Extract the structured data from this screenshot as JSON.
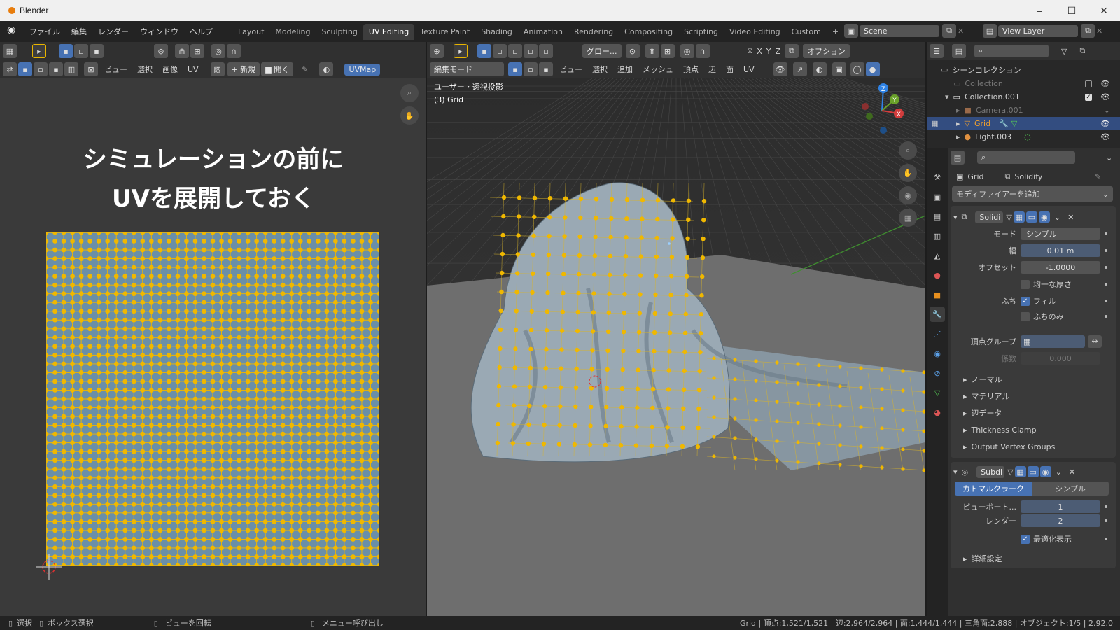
{
  "window": {
    "title": "Blender",
    "min": "–",
    "max": "☐",
    "close": "✕"
  },
  "menus": [
    "ファイル",
    "編集",
    "レンダー",
    "ウィンドウ",
    "ヘルプ"
  ],
  "workspaces": [
    "Layout",
    "Modeling",
    "Sculpting",
    "UV Editing",
    "Texture Paint",
    "Shading",
    "Animation",
    "Rendering",
    "Compositing",
    "Scripting",
    "Video Editing",
    "Custom"
  ],
  "active_workspace": "UV Editing",
  "add_workspace": "+",
  "scene": {
    "label": "Scene",
    "view_layer": "View Layer"
  },
  "uv_editor": {
    "menus": [
      "ビュー",
      "選択",
      "画像",
      "UV"
    ],
    "new_label": "新規",
    "open_label": "開く",
    "uvmap_label": "UVMap",
    "title_line1": "シミュレーションの前に",
    "title_line2": "UVを展開しておく"
  },
  "viewport": {
    "mode_label": "編集モード",
    "menus": [
      "ビュー",
      "選択",
      "追加",
      "メッシュ",
      "頂点",
      "辺",
      "面",
      "UV"
    ],
    "transform_label": "グロー...",
    "options_label": "オプション",
    "axes": [
      "X",
      "Y",
      "Z"
    ],
    "overlay_line1": "ユーザー・透視投影",
    "overlay_line2": "(3) Grid",
    "gizmo_axes": [
      "Z",
      "Y",
      "X"
    ]
  },
  "outliner": {
    "header": "シーンコレクション",
    "items": [
      {
        "label": "Collection",
        "dim": true
      },
      {
        "label": "Collection.001",
        "dim": false
      },
      {
        "label": "Camera.001",
        "dim": true
      },
      {
        "label": "Grid",
        "dim": false,
        "selected": true
      },
      {
        "label": "Light.003",
        "dim": false
      }
    ]
  },
  "properties": {
    "object_name": "Grid",
    "modifier_name_top": "Solidify",
    "add_modifier": "モディファイアーを追加",
    "solidify": {
      "name": "Solidi",
      "mode_label": "モード",
      "mode_value": "シンプル",
      "width_label": "幅",
      "width_value": "0.01 m",
      "offset_label": "オフセット",
      "offset_value": "-1.0000",
      "even_label": "均一な厚さ",
      "rim_label": "ふち",
      "fill_label": "フィル",
      "rim_only_label": "ふちのみ",
      "vgroup_label": "頂点グループ",
      "factor_label": "係数",
      "factor_value": "0.000",
      "sections": [
        "ノーマル",
        "マテリアル",
        "辺データ",
        "Thickness Clamp",
        "Output Vertex Groups"
      ]
    },
    "subdivision": {
      "name": "Subdi",
      "catmull_label": "カトマルクラーク",
      "simple_label": "シンプル",
      "viewport_label": "ビューポート...",
      "viewport_value": "1",
      "render_label": "レンダー",
      "render_value": "2",
      "optimal_label": "最適化表示",
      "advanced_label": "詳細設定"
    }
  },
  "statusbar": {
    "select": "選択",
    "box_select": "ボックス選択",
    "rotate_view": "ビューを回転",
    "call_menu": "メニュー呼び出し",
    "stats": "Grid | 頂点:1,521/1,521 | 辺:2,964/2,964 | 面:1,444/1,444 | 三角面:2,888 | オブジェクト:1/5 | 2.92.0"
  },
  "colors": {
    "accent": "#4772b3",
    "vertex": "#f0b800",
    "uv_face": "#6a8fa8",
    "active_tab": "#3d3d3d"
  }
}
